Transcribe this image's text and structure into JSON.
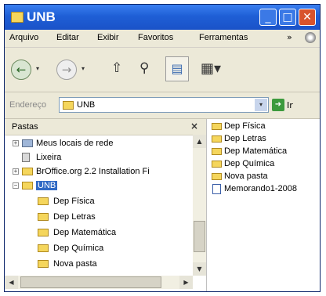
{
  "window": {
    "title": "UNB",
    "minimize_glyph": "_",
    "maximize_glyph": "□",
    "close_glyph": "✕"
  },
  "menu": {
    "items": [
      "Arquivo",
      "Editar",
      "Exibir",
      "Favoritos",
      "Ferramentas"
    ],
    "more_glyph": "»"
  },
  "toolbar": {
    "back_glyph": "←",
    "forward_glyph": "→",
    "caret_glyph": "▾",
    "up_glyph": "⇧",
    "search_glyph": "⚲",
    "folders_glyph": "▤",
    "views_glyph": "▦▾"
  },
  "address": {
    "label": "Endereço",
    "value": "UNB",
    "dropdown_glyph": "▾",
    "go_glyph": "➜",
    "go_label": "Ir"
  },
  "folders_pane": {
    "title": "Pastas",
    "close_glyph": "×",
    "tree": [
      {
        "label": "Meus locais de rede",
        "expander": "+",
        "icon": "network-places-icon"
      },
      {
        "label": "Lixeira",
        "expander": "",
        "icon": "recycle-bin-icon"
      },
      {
        "label": "BrOffice.org 2.2 Installation Fi",
        "expander": "+",
        "icon": "folder-icon"
      },
      {
        "label": "UNB",
        "expander": "−",
        "icon": "folder-icon",
        "selected": true
      },
      {
        "label": "Dep Física",
        "expander": "",
        "icon": "folder-icon"
      },
      {
        "label": "Dep Letras",
        "expander": "",
        "icon": "folder-icon"
      },
      {
        "label": "Dep Matemática",
        "expander": "",
        "icon": "folder-icon"
      },
      {
        "label": "Dep Química",
        "expander": "",
        "icon": "folder-icon"
      },
      {
        "label": "Nova pasta",
        "expander": "",
        "icon": "folder-icon"
      }
    ],
    "scroll_up_glyph": "▲",
    "scroll_down_glyph": "▼",
    "scroll_left_glyph": "◀",
    "scroll_right_glyph": "▶"
  },
  "files": [
    {
      "label": "Dep Física",
      "icon": "folder-icon"
    },
    {
      "label": "Dep Letras",
      "icon": "folder-icon"
    },
    {
      "label": "Dep Matemática",
      "icon": "folder-icon"
    },
    {
      "label": "Dep Química",
      "icon": "folder-icon"
    },
    {
      "label": "Nova pasta",
      "icon": "folder-icon"
    },
    {
      "label": "Memorando1-2008",
      "icon": "document-icon"
    }
  ],
  "colors": {
    "titlebar": "#1f5fd6",
    "selection": "#316ac5",
    "folder": "#f5d65c"
  }
}
